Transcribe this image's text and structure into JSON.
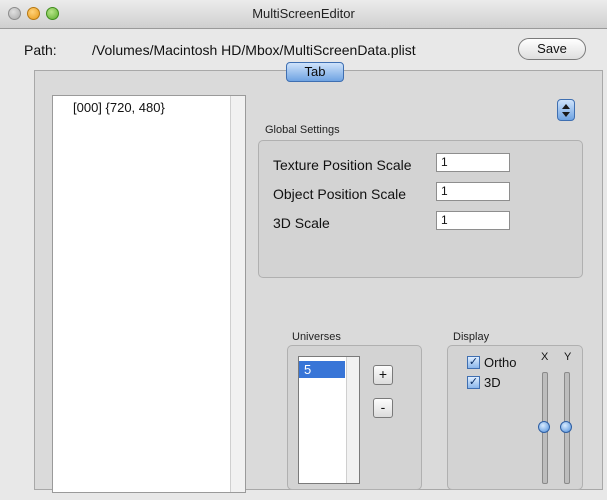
{
  "window": {
    "title": "MultiScreenEditor"
  },
  "path": {
    "label": "Path:",
    "value": "/Volumes/Macintosh HD/Mbox/MultiScreenData.plist"
  },
  "toolbar": {
    "save_label": "Save"
  },
  "tab": {
    "label": "Tab"
  },
  "screen_list": {
    "items": [
      "[000]  {720, 480}"
    ]
  },
  "global_settings": {
    "title": "Global Settings",
    "rows": [
      {
        "label": "Texture Position Scale",
        "value": "1"
      },
      {
        "label": "Object Position Scale",
        "value": "1"
      },
      {
        "label": "3D Scale",
        "value": "1"
      }
    ]
  },
  "universes": {
    "title": "Universes",
    "items": [
      "5"
    ],
    "add_label": "+",
    "remove_label": "-"
  },
  "display": {
    "title": "Display",
    "ortho": {
      "label": "Ortho",
      "checked": true
    },
    "three_d": {
      "label": "3D",
      "checked": true
    },
    "x_label": "X",
    "y_label": "Y",
    "x_slider_value": 0.5,
    "y_slider_value": 0.5
  },
  "colors": {
    "accent": "#3875d7"
  }
}
